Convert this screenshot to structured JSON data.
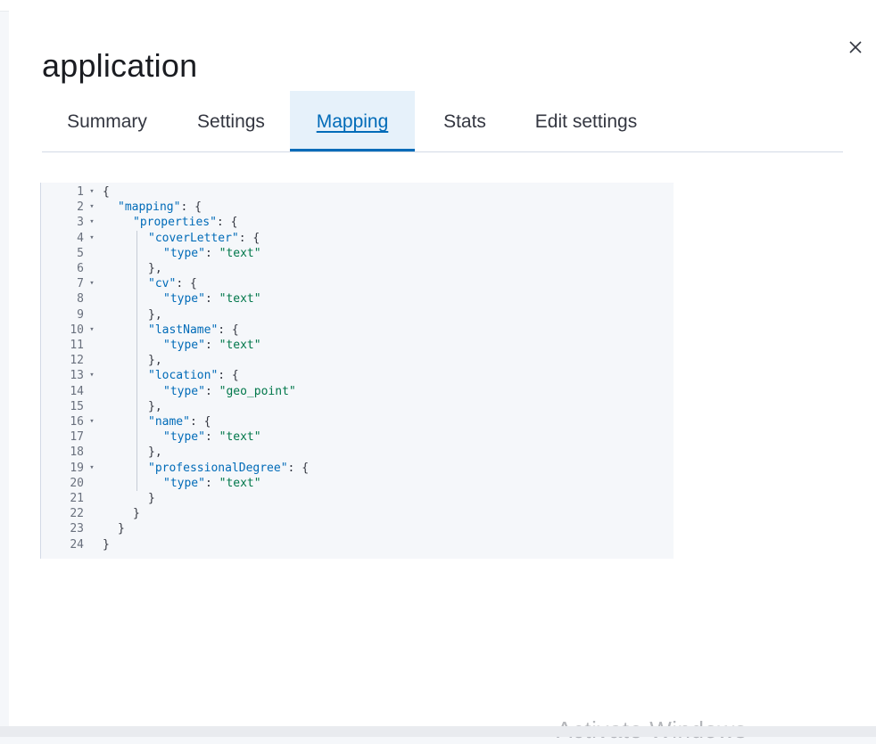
{
  "flyout": {
    "title": "application",
    "close_icon": "close-icon"
  },
  "tabs": [
    {
      "label": "Summary",
      "active": false
    },
    {
      "label": "Settings",
      "active": false
    },
    {
      "label": "Mapping",
      "active": true
    },
    {
      "label": "Stats",
      "active": false
    },
    {
      "label": "Edit settings",
      "active": false
    }
  ],
  "editor": {
    "lines": [
      {
        "num": "1",
        "fold": true,
        "indent": 0,
        "tokens": [
          {
            "t": "{",
            "c": "p"
          }
        ]
      },
      {
        "num": "2",
        "fold": true,
        "indent": 1,
        "tokens": [
          {
            "t": "\"mapping\"",
            "c": "k"
          },
          {
            "t": ": {",
            "c": "p"
          }
        ]
      },
      {
        "num": "3",
        "fold": true,
        "indent": 2,
        "tokens": [
          {
            "t": "\"properties\"",
            "c": "k"
          },
          {
            "t": ": {",
            "c": "p"
          }
        ]
      },
      {
        "num": "4",
        "fold": true,
        "indent": 3,
        "tokens": [
          {
            "t": "\"coverLetter\"",
            "c": "k"
          },
          {
            "t": ": {",
            "c": "p"
          }
        ]
      },
      {
        "num": "5",
        "fold": false,
        "indent": 4,
        "tokens": [
          {
            "t": "\"type\"",
            "c": "k"
          },
          {
            "t": ": ",
            "c": "p"
          },
          {
            "t": "\"text\"",
            "c": "s"
          }
        ]
      },
      {
        "num": "6",
        "fold": false,
        "indent": 3,
        "tokens": [
          {
            "t": "},",
            "c": "p"
          }
        ]
      },
      {
        "num": "7",
        "fold": true,
        "indent": 3,
        "tokens": [
          {
            "t": "\"cv\"",
            "c": "k"
          },
          {
            "t": ": {",
            "c": "p"
          }
        ]
      },
      {
        "num": "8",
        "fold": false,
        "indent": 4,
        "tokens": [
          {
            "t": "\"type\"",
            "c": "k"
          },
          {
            "t": ": ",
            "c": "p"
          },
          {
            "t": "\"text\"",
            "c": "s"
          }
        ]
      },
      {
        "num": "9",
        "fold": false,
        "indent": 3,
        "tokens": [
          {
            "t": "},",
            "c": "p"
          }
        ]
      },
      {
        "num": "10",
        "fold": true,
        "indent": 3,
        "tokens": [
          {
            "t": "\"lastName\"",
            "c": "k"
          },
          {
            "t": ": {",
            "c": "p"
          }
        ]
      },
      {
        "num": "11",
        "fold": false,
        "indent": 4,
        "tokens": [
          {
            "t": "\"type\"",
            "c": "k"
          },
          {
            "t": ": ",
            "c": "p"
          },
          {
            "t": "\"text\"",
            "c": "s"
          }
        ]
      },
      {
        "num": "12",
        "fold": false,
        "indent": 3,
        "tokens": [
          {
            "t": "},",
            "c": "p"
          }
        ]
      },
      {
        "num": "13",
        "fold": true,
        "indent": 3,
        "tokens": [
          {
            "t": "\"location\"",
            "c": "k"
          },
          {
            "t": ": {",
            "c": "p"
          }
        ]
      },
      {
        "num": "14",
        "fold": false,
        "indent": 4,
        "tokens": [
          {
            "t": "\"type\"",
            "c": "k"
          },
          {
            "t": ": ",
            "c": "p"
          },
          {
            "t": "\"geo_point\"",
            "c": "s"
          }
        ]
      },
      {
        "num": "15",
        "fold": false,
        "indent": 3,
        "tokens": [
          {
            "t": "},",
            "c": "p"
          }
        ]
      },
      {
        "num": "16",
        "fold": true,
        "indent": 3,
        "tokens": [
          {
            "t": "\"name\"",
            "c": "k"
          },
          {
            "t": ": {",
            "c": "p"
          }
        ]
      },
      {
        "num": "17",
        "fold": false,
        "indent": 4,
        "tokens": [
          {
            "t": "\"type\"",
            "c": "k"
          },
          {
            "t": ": ",
            "c": "p"
          },
          {
            "t": "\"text\"",
            "c": "s"
          }
        ]
      },
      {
        "num": "18",
        "fold": false,
        "indent": 3,
        "tokens": [
          {
            "t": "},",
            "c": "p"
          }
        ]
      },
      {
        "num": "19",
        "fold": true,
        "indent": 3,
        "tokens": [
          {
            "t": "\"professionalDegree\"",
            "c": "k"
          },
          {
            "t": ": {",
            "c": "p"
          }
        ]
      },
      {
        "num": "20",
        "fold": false,
        "indent": 4,
        "tokens": [
          {
            "t": "\"type\"",
            "c": "k"
          },
          {
            "t": ": ",
            "c": "p"
          },
          {
            "t": "\"text\"",
            "c": "s"
          }
        ]
      },
      {
        "num": "21",
        "fold": false,
        "indent": 3,
        "tokens": [
          {
            "t": "}",
            "c": "p"
          }
        ]
      },
      {
        "num": "22",
        "fold": false,
        "indent": 2,
        "tokens": [
          {
            "t": "}",
            "c": "p"
          }
        ]
      },
      {
        "num": "23",
        "fold": false,
        "indent": 1,
        "tokens": [
          {
            "t": "}",
            "c": "p"
          }
        ]
      },
      {
        "num": "24",
        "fold": false,
        "indent": 0,
        "tokens": [
          {
            "t": "}",
            "c": "p"
          }
        ]
      }
    ]
  },
  "watermark": {
    "text": "Activate Windows"
  },
  "colors": {
    "accent": "#006bb8",
    "active_tab_bg": "#e6f1fa",
    "json_key": "#006bb8",
    "json_string": "#00774a",
    "editor_bg": "#f5f7fa"
  }
}
